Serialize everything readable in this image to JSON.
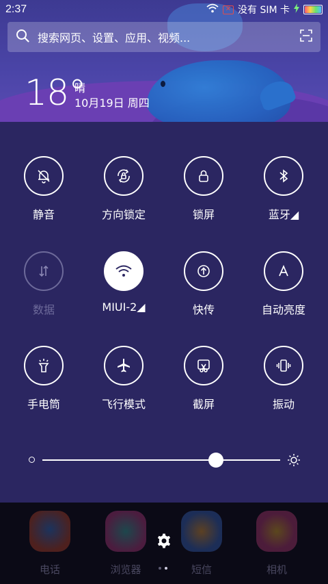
{
  "status_bar": {
    "time": "2:37",
    "carrier": "没有 SIM 卡",
    "sim_x": "✕"
  },
  "search": {
    "placeholder": "搜索网页、设置、应用、视频..."
  },
  "weather": {
    "temperature": "18°",
    "condition": "晴",
    "date": "10月19日 周四"
  },
  "toggles": [
    {
      "label": "静音",
      "icon": "bell-off-icon",
      "state": "off"
    },
    {
      "label": "方向锁定",
      "icon": "rotation-lock-icon",
      "state": "off"
    },
    {
      "label": "锁屏",
      "icon": "lock-icon",
      "state": "off"
    },
    {
      "label": "蓝牙◢",
      "icon": "bluetooth-icon",
      "state": "off"
    },
    {
      "label": "数据",
      "icon": "data-arrows-icon",
      "state": "disabled"
    },
    {
      "label": "MIUI-2◢",
      "icon": "wifi-icon",
      "state": "on"
    },
    {
      "label": "快传",
      "icon": "quick-transfer-icon",
      "state": "off"
    },
    {
      "label": "自动亮度",
      "icon": "auto-brightness-icon",
      "state": "off"
    },
    {
      "label": "手电筒",
      "icon": "flashlight-icon",
      "state": "off"
    },
    {
      "label": "飞行模式",
      "icon": "airplane-icon",
      "state": "off"
    },
    {
      "label": "截屏",
      "icon": "screenshot-icon",
      "state": "off"
    },
    {
      "label": "振动",
      "icon": "vibrate-icon",
      "state": "off"
    }
  ],
  "brightness": {
    "level": 0.73
  },
  "dock": {
    "apps": [
      {
        "label": "电话",
        "color": "#e0562e"
      },
      {
        "label": "浏览器",
        "color": "#d6479a"
      },
      {
        "label": "短信",
        "color": "#e8862b"
      },
      {
        "label": "相机",
        "color": "#d4458a"
      }
    ]
  },
  "colors": {
    "panel": "#2b2661",
    "header": "#4b45a8",
    "dock": "#0b0a16"
  }
}
